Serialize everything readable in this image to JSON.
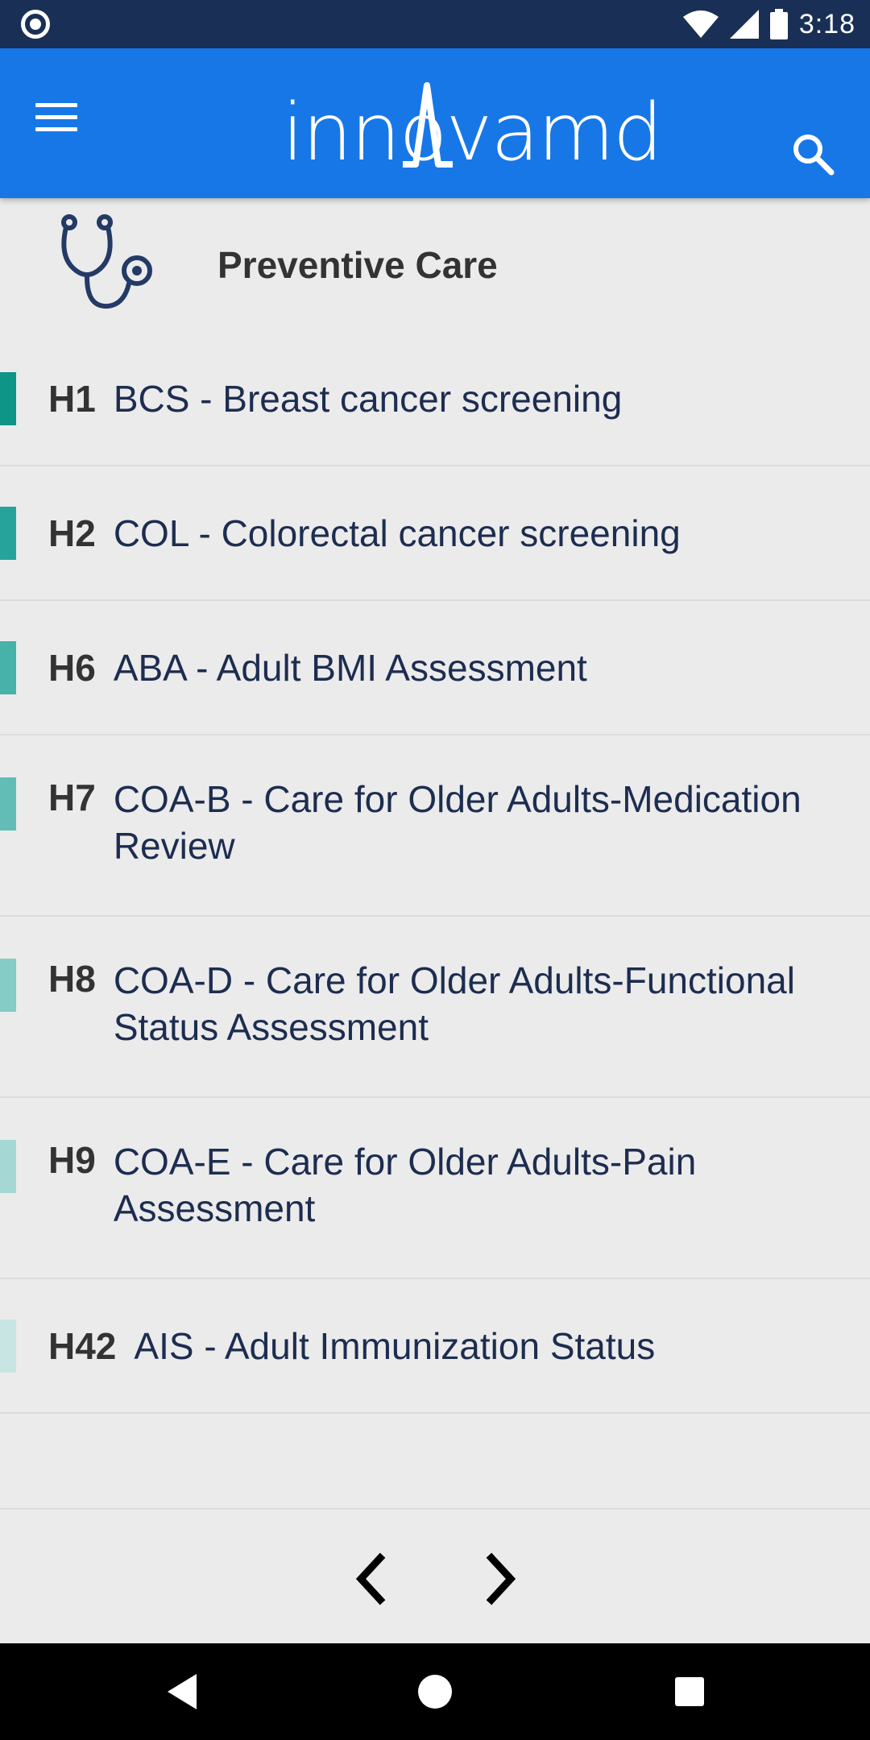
{
  "status": {
    "time": "3:18"
  },
  "appbar": {
    "logo_text": "innovamd"
  },
  "section": {
    "title": "Preventive Care"
  },
  "measures": [
    {
      "code": "H1",
      "label": "BCS - Breast cancer screening",
      "color": "#0f9488"
    },
    {
      "code": "H2",
      "label": "COL - Colorectal cancer screening",
      "color": "#26a49b"
    },
    {
      "code": "H6",
      "label": "ABA - Adult BMI Assessment",
      "color": "#46b2aa"
    },
    {
      "code": "H7",
      "label": "COA-B - Care for Older Adults-Medication Review",
      "color": "#62bdb6"
    },
    {
      "code": "H8",
      "label": "COA-D - Care for Older Adults-Functional Status Assessment",
      "color": "#85cbc6"
    },
    {
      "code": "H9",
      "label": "COA-E - Care for Older Adults-Pain Assessment",
      "color": "#a5d7d4"
    },
    {
      "code": "H42",
      "label": "AIS - Adult Immunization Status",
      "color": "#c8e5e3"
    }
  ],
  "colors": {
    "statusbar": "#1a2f55",
    "appbar": "#1877e6",
    "background": "#ebebeb",
    "text": "#1d2d50"
  }
}
